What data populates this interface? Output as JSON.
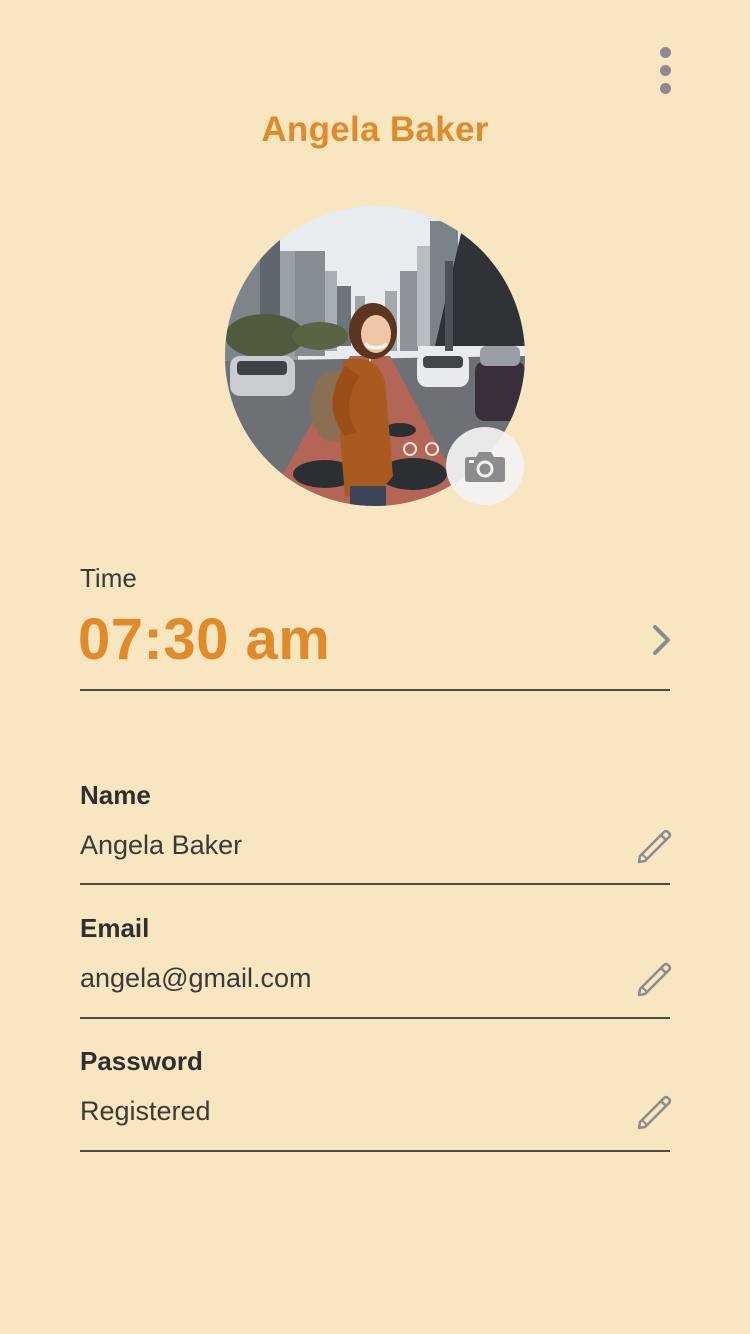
{
  "header": {
    "menu_icon": "more-vertical-icon",
    "profile_name": "Angela Baker"
  },
  "avatar": {
    "alt": "Profile photo",
    "camera_icon": "camera-icon"
  },
  "time": {
    "caption": "Time",
    "value": "07:30 am",
    "chevron_icon": "chevron-right-icon"
  },
  "fields": [
    {
      "label": "Name",
      "value": "Angela Baker",
      "edit_icon": "pencil-icon"
    },
    {
      "label": "Email",
      "value": "angela@gmail.com",
      "edit_icon": "pencil-icon"
    },
    {
      "label": "Password",
      "value": "Registered",
      "edit_icon": "pencil-icon"
    }
  ],
  "colors": {
    "background": "#f8e6c1",
    "accent": "#e08a2a",
    "text": "#2f2f2f",
    "icon": "#8c8c8c"
  }
}
